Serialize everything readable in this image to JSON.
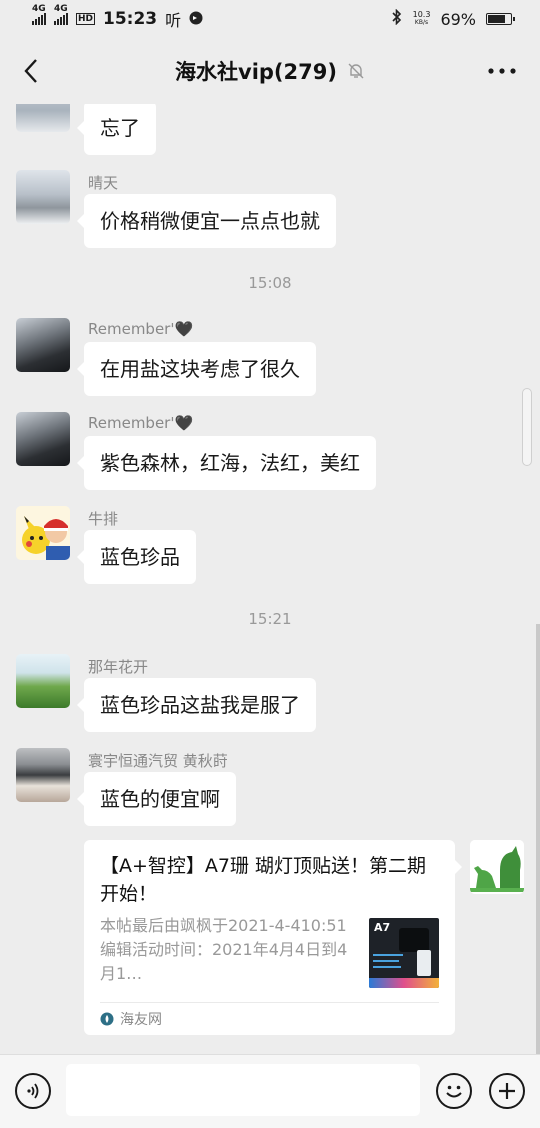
{
  "status_bar": {
    "network1": "4G",
    "network2": "4G",
    "hd": "HD",
    "time": "15:23",
    "app_mark": "听",
    "speed_value": "10.3",
    "speed_unit": "KB/s",
    "battery_text": "69%",
    "battery_level": 0.69
  },
  "header": {
    "title": "海水社vip(279)",
    "back_icon": "chevron-left-icon",
    "mute_icon": "bell-off-icon",
    "more_icon": "more-dots-icon"
  },
  "messages": [
    {
      "sender": "",
      "text": "忘了"
    },
    {
      "sender": "晴天",
      "text": "价格稍微便宜一点点也就"
    },
    {
      "timestamp": "15:08"
    },
    {
      "sender": "Remember'🖤",
      "text": "在用盐这块考虑了很久"
    },
    {
      "sender": "Remember'🖤",
      "text": "紫色森林，红海，法红，美红"
    },
    {
      "sender": "牛排",
      "text": "蓝色珍品"
    },
    {
      "timestamp": "15:21"
    },
    {
      "sender": "那年花开",
      "text": "蓝色珍品这盐我是服了"
    },
    {
      "sender": "寰宇恒通汽贸 黄秋莳",
      "text": "蓝色的便宜啊"
    }
  ],
  "link_card": {
    "title": "【A+智控】A7珊 瑚灯顶贴送！第二期开始！",
    "description": "本帖最后由飒枫于2021-4-410:51编辑活动时间：2021年4月4日到4月1…",
    "thumb_label": "A7",
    "source": "海友网"
  },
  "input_bar": {
    "voice_icon": "voice-icon",
    "placeholder": "",
    "emoji_icon": "emoji-icon",
    "plus_icon": "plus-icon"
  }
}
